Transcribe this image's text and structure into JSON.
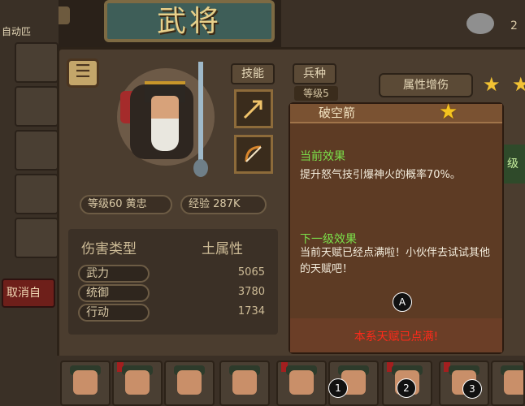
{
  "header": {
    "title": "武将",
    "coin_count": "2"
  },
  "left_panel": {
    "auto_label": "自动匹",
    "cancel_label": "取消自"
  },
  "hero": {
    "tabs": [
      "技能",
      "兵种"
    ],
    "skill_level": "等级5",
    "level_name": "等级60 黄忠",
    "exp": "经验 287K"
  },
  "stats": {
    "damage_type_label": "伤害类型",
    "damage_type_value": "土属性",
    "rows": [
      {
        "label": "武力",
        "value": "5065"
      },
      {
        "label": "统御",
        "value": "3780"
      },
      {
        "label": "行动",
        "value": "1734"
      }
    ]
  },
  "right_panel": {
    "attr_button": "属性增伤",
    "green_badge": "级"
  },
  "popup": {
    "title": "破空箭",
    "current_effect_label": "当前效果",
    "current_effect_text": "提升怒气技引爆神火的概率70%。",
    "next_effect_label": "下一级效果",
    "next_effect_text": "当前天赋已经点满啦！小伙伴去试试其他的天赋吧！",
    "marker": "A",
    "footer_note": "本系天赋已点满!"
  },
  "roster": {
    "markers": [
      "1",
      "2",
      "3"
    ]
  },
  "colors": {
    "accent_gold": "#f5c31f",
    "effect_green": "#7be04a",
    "warning_red": "#ff2a1a"
  }
}
